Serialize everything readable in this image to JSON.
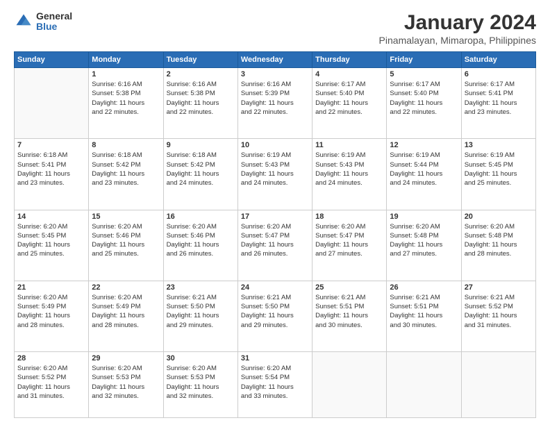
{
  "logo": {
    "general": "General",
    "blue": "Blue"
  },
  "title": "January 2024",
  "subtitle": "Pinamalayan, Mimaropa, Philippines",
  "weekdays": [
    "Sunday",
    "Monday",
    "Tuesday",
    "Wednesday",
    "Thursday",
    "Friday",
    "Saturday"
  ],
  "weeks": [
    [
      {
        "day": "",
        "info": ""
      },
      {
        "day": "1",
        "info": "Sunrise: 6:16 AM\nSunset: 5:38 PM\nDaylight: 11 hours\nand 22 minutes."
      },
      {
        "day": "2",
        "info": "Sunrise: 6:16 AM\nSunset: 5:38 PM\nDaylight: 11 hours\nand 22 minutes."
      },
      {
        "day": "3",
        "info": "Sunrise: 6:16 AM\nSunset: 5:39 PM\nDaylight: 11 hours\nand 22 minutes."
      },
      {
        "day": "4",
        "info": "Sunrise: 6:17 AM\nSunset: 5:40 PM\nDaylight: 11 hours\nand 22 minutes."
      },
      {
        "day": "5",
        "info": "Sunrise: 6:17 AM\nSunset: 5:40 PM\nDaylight: 11 hours\nand 22 minutes."
      },
      {
        "day": "6",
        "info": "Sunrise: 6:17 AM\nSunset: 5:41 PM\nDaylight: 11 hours\nand 23 minutes."
      }
    ],
    [
      {
        "day": "7",
        "info": "Sunrise: 6:18 AM\nSunset: 5:41 PM\nDaylight: 11 hours\nand 23 minutes."
      },
      {
        "day": "8",
        "info": "Sunrise: 6:18 AM\nSunset: 5:42 PM\nDaylight: 11 hours\nand 23 minutes."
      },
      {
        "day": "9",
        "info": "Sunrise: 6:18 AM\nSunset: 5:42 PM\nDaylight: 11 hours\nand 24 minutes."
      },
      {
        "day": "10",
        "info": "Sunrise: 6:19 AM\nSunset: 5:43 PM\nDaylight: 11 hours\nand 24 minutes."
      },
      {
        "day": "11",
        "info": "Sunrise: 6:19 AM\nSunset: 5:43 PM\nDaylight: 11 hours\nand 24 minutes."
      },
      {
        "day": "12",
        "info": "Sunrise: 6:19 AM\nSunset: 5:44 PM\nDaylight: 11 hours\nand 24 minutes."
      },
      {
        "day": "13",
        "info": "Sunrise: 6:19 AM\nSunset: 5:45 PM\nDaylight: 11 hours\nand 25 minutes."
      }
    ],
    [
      {
        "day": "14",
        "info": "Sunrise: 6:20 AM\nSunset: 5:45 PM\nDaylight: 11 hours\nand 25 minutes."
      },
      {
        "day": "15",
        "info": "Sunrise: 6:20 AM\nSunset: 5:46 PM\nDaylight: 11 hours\nand 25 minutes."
      },
      {
        "day": "16",
        "info": "Sunrise: 6:20 AM\nSunset: 5:46 PM\nDaylight: 11 hours\nand 26 minutes."
      },
      {
        "day": "17",
        "info": "Sunrise: 6:20 AM\nSunset: 5:47 PM\nDaylight: 11 hours\nand 26 minutes."
      },
      {
        "day": "18",
        "info": "Sunrise: 6:20 AM\nSunset: 5:47 PM\nDaylight: 11 hours\nand 27 minutes."
      },
      {
        "day": "19",
        "info": "Sunrise: 6:20 AM\nSunset: 5:48 PM\nDaylight: 11 hours\nand 27 minutes."
      },
      {
        "day": "20",
        "info": "Sunrise: 6:20 AM\nSunset: 5:48 PM\nDaylight: 11 hours\nand 28 minutes."
      }
    ],
    [
      {
        "day": "21",
        "info": "Sunrise: 6:20 AM\nSunset: 5:49 PM\nDaylight: 11 hours\nand 28 minutes."
      },
      {
        "day": "22",
        "info": "Sunrise: 6:20 AM\nSunset: 5:49 PM\nDaylight: 11 hours\nand 28 minutes."
      },
      {
        "day": "23",
        "info": "Sunrise: 6:21 AM\nSunset: 5:50 PM\nDaylight: 11 hours\nand 29 minutes."
      },
      {
        "day": "24",
        "info": "Sunrise: 6:21 AM\nSunset: 5:50 PM\nDaylight: 11 hours\nand 29 minutes."
      },
      {
        "day": "25",
        "info": "Sunrise: 6:21 AM\nSunset: 5:51 PM\nDaylight: 11 hours\nand 30 minutes."
      },
      {
        "day": "26",
        "info": "Sunrise: 6:21 AM\nSunset: 5:51 PM\nDaylight: 11 hours\nand 30 minutes."
      },
      {
        "day": "27",
        "info": "Sunrise: 6:21 AM\nSunset: 5:52 PM\nDaylight: 11 hours\nand 31 minutes."
      }
    ],
    [
      {
        "day": "28",
        "info": "Sunrise: 6:20 AM\nSunset: 5:52 PM\nDaylight: 11 hours\nand 31 minutes."
      },
      {
        "day": "29",
        "info": "Sunrise: 6:20 AM\nSunset: 5:53 PM\nDaylight: 11 hours\nand 32 minutes."
      },
      {
        "day": "30",
        "info": "Sunrise: 6:20 AM\nSunset: 5:53 PM\nDaylight: 11 hours\nand 32 minutes."
      },
      {
        "day": "31",
        "info": "Sunrise: 6:20 AM\nSunset: 5:54 PM\nDaylight: 11 hours\nand 33 minutes."
      },
      {
        "day": "",
        "info": ""
      },
      {
        "day": "",
        "info": ""
      },
      {
        "day": "",
        "info": ""
      }
    ]
  ]
}
